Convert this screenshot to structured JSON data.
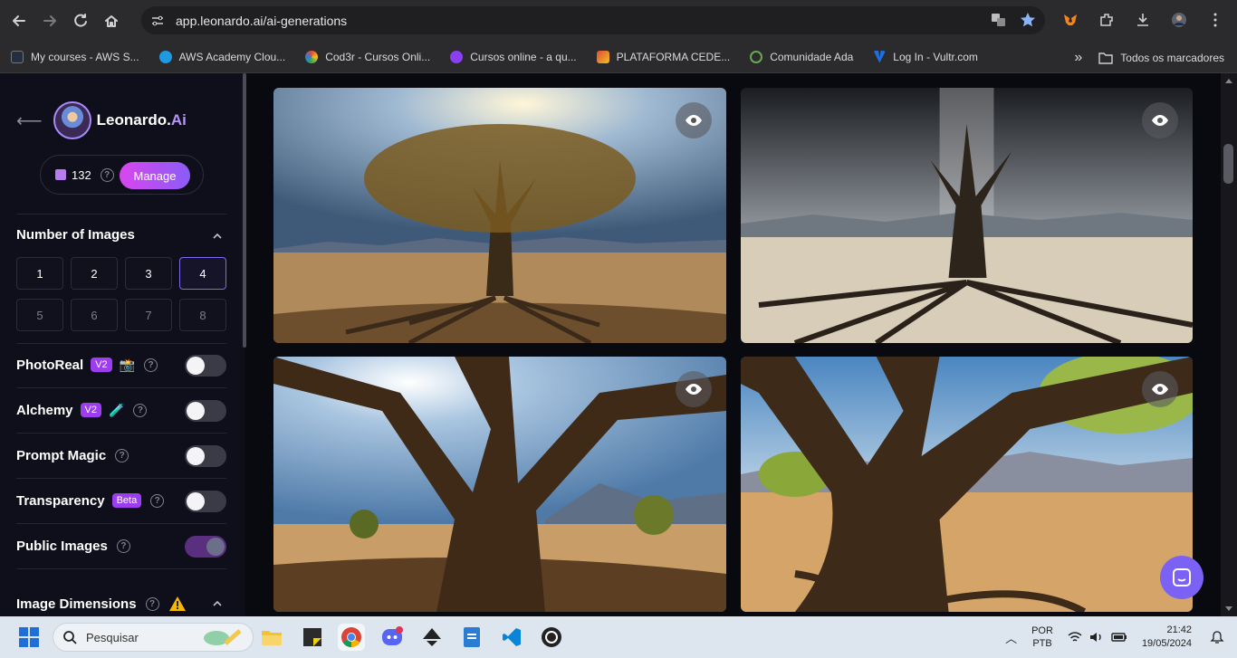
{
  "browser": {
    "url": "app.leonardo.ai/ai-generations",
    "bookmarks": [
      {
        "label": "My courses - AWS S...",
        "color": "#232f3e"
      },
      {
        "label": "AWS Academy Clou...",
        "color": "#1f9ae0"
      },
      {
        "label": "Cod3r - Cursos Onli...",
        "color": "#e04b3a"
      },
      {
        "label": "Cursos online - a qu...",
        "color": "#8a3ff0"
      },
      {
        "label": "PLATAFORMA CEDE...",
        "color": "#e0a020"
      },
      {
        "label": "Comunidade Ada",
        "color": "#6aa84f"
      },
      {
        "label": "Log In - Vultr.com",
        "color": "#1f6fe0"
      }
    ],
    "all_bookmarks_label": "Todos os marcadores"
  },
  "sidebar": {
    "brand_name": "Leonardo.",
    "brand_ai": "Ai",
    "token_count": "132",
    "manage_label": "Manage",
    "number_of_images_title": "Number of Images",
    "number_options": [
      "1",
      "2",
      "3",
      "4",
      "5",
      "6",
      "7",
      "8"
    ],
    "selected_number": "4",
    "settings": [
      {
        "label": "PhotoReal",
        "badge": "V2",
        "on": false
      },
      {
        "label": "Alchemy",
        "badge": "V2",
        "on": false
      },
      {
        "label": "Prompt Magic",
        "badge": "",
        "on": false
      },
      {
        "label": "Transparency",
        "badge": "Beta",
        "on": false
      },
      {
        "label": "Public Images",
        "badge": "",
        "on": true
      }
    ],
    "image_dimensions_title": "Image Dimensions"
  },
  "taskbar": {
    "search_placeholder": "Pesquisar",
    "lang_line1": "POR",
    "lang_line2": "PTB",
    "time": "21:42",
    "date": "19/05/2024"
  }
}
